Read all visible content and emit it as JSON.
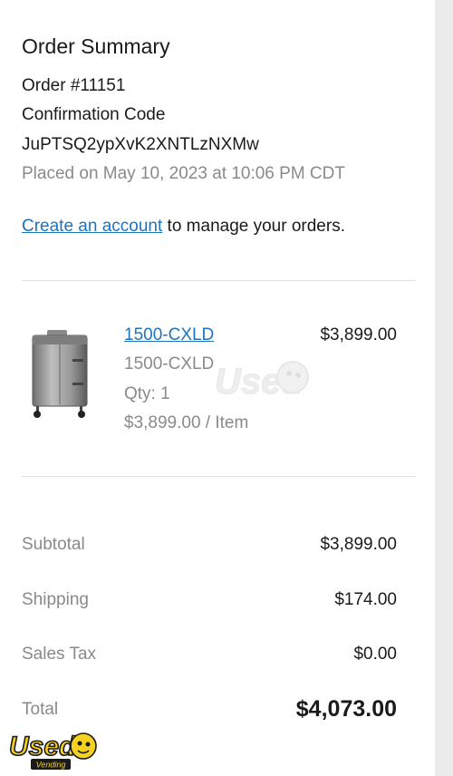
{
  "summary": {
    "title": "Order Summary",
    "order_number": "Order #11151",
    "confirmation_label": "Confirmation Code",
    "confirmation_code": "JuPTSQ2ypXvK2XNTLzNXMw",
    "placed_on": "Placed on May 10, 2023 at 10:06 PM CDT"
  },
  "account": {
    "link_text": "Create an account",
    "suffix_text": " to manage your orders."
  },
  "product": {
    "name": "1500-CXLD",
    "price": "$3,899.00",
    "sku": "1500-CXLD",
    "qty": "Qty: 1",
    "unit_price": "$3,899.00 / Item"
  },
  "totals": {
    "subtotal_label": "Subtotal",
    "subtotal_value": "$3,899.00",
    "shipping_label": "Shipping",
    "shipping_value": "$174.00",
    "tax_label": "Sales Tax",
    "tax_value": "$0.00",
    "total_label": "Total",
    "total_value": "$4,073.00"
  },
  "watermark": {
    "brand": "Used",
    "subtext": "Vending"
  },
  "colors": {
    "link": "#1e73be",
    "muted": "#8a8a8a",
    "text": "#1a1a1a",
    "logo_yellow": "#f4d21f"
  }
}
